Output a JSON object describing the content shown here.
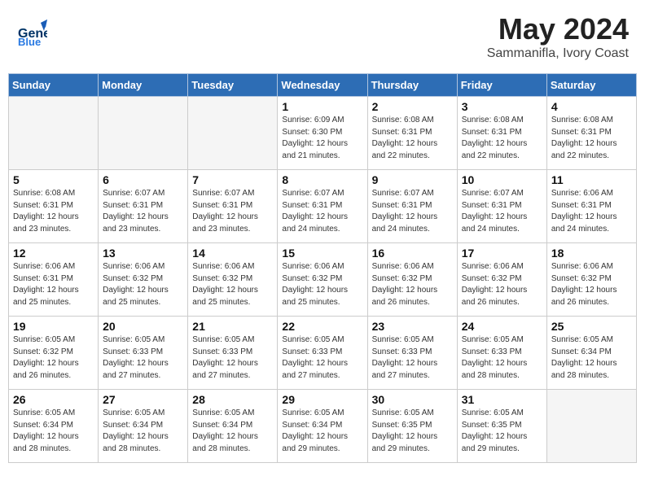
{
  "header": {
    "logo_general": "General",
    "logo_blue": "Blue",
    "month": "May 2024",
    "location": "Sammanifla, Ivory Coast"
  },
  "days_of_week": [
    "Sunday",
    "Monday",
    "Tuesday",
    "Wednesday",
    "Thursday",
    "Friday",
    "Saturday"
  ],
  "weeks": [
    {
      "alt": false,
      "days": [
        {
          "num": "",
          "empty": true,
          "sunrise": "",
          "sunset": "",
          "daylight": ""
        },
        {
          "num": "",
          "empty": true,
          "sunrise": "",
          "sunset": "",
          "daylight": ""
        },
        {
          "num": "",
          "empty": true,
          "sunrise": "",
          "sunset": "",
          "daylight": ""
        },
        {
          "num": "1",
          "empty": false,
          "sunrise": "Sunrise: 6:09 AM",
          "sunset": "Sunset: 6:30 PM",
          "daylight": "Daylight: 12 hours and 21 minutes."
        },
        {
          "num": "2",
          "empty": false,
          "sunrise": "Sunrise: 6:08 AM",
          "sunset": "Sunset: 6:31 PM",
          "daylight": "Daylight: 12 hours and 22 minutes."
        },
        {
          "num": "3",
          "empty": false,
          "sunrise": "Sunrise: 6:08 AM",
          "sunset": "Sunset: 6:31 PM",
          "daylight": "Daylight: 12 hours and 22 minutes."
        },
        {
          "num": "4",
          "empty": false,
          "sunrise": "Sunrise: 6:08 AM",
          "sunset": "Sunset: 6:31 PM",
          "daylight": "Daylight: 12 hours and 22 minutes."
        }
      ]
    },
    {
      "alt": true,
      "days": [
        {
          "num": "5",
          "empty": false,
          "sunrise": "Sunrise: 6:08 AM",
          "sunset": "Sunset: 6:31 PM",
          "daylight": "Daylight: 12 hours and 23 minutes."
        },
        {
          "num": "6",
          "empty": false,
          "sunrise": "Sunrise: 6:07 AM",
          "sunset": "Sunset: 6:31 PM",
          "daylight": "Daylight: 12 hours and 23 minutes."
        },
        {
          "num": "7",
          "empty": false,
          "sunrise": "Sunrise: 6:07 AM",
          "sunset": "Sunset: 6:31 PM",
          "daylight": "Daylight: 12 hours and 23 minutes."
        },
        {
          "num": "8",
          "empty": false,
          "sunrise": "Sunrise: 6:07 AM",
          "sunset": "Sunset: 6:31 PM",
          "daylight": "Daylight: 12 hours and 24 minutes."
        },
        {
          "num": "9",
          "empty": false,
          "sunrise": "Sunrise: 6:07 AM",
          "sunset": "Sunset: 6:31 PM",
          "daylight": "Daylight: 12 hours and 24 minutes."
        },
        {
          "num": "10",
          "empty": false,
          "sunrise": "Sunrise: 6:07 AM",
          "sunset": "Sunset: 6:31 PM",
          "daylight": "Daylight: 12 hours and 24 minutes."
        },
        {
          "num": "11",
          "empty": false,
          "sunrise": "Sunrise: 6:06 AM",
          "sunset": "Sunset: 6:31 PM",
          "daylight": "Daylight: 12 hours and 24 minutes."
        }
      ]
    },
    {
      "alt": false,
      "days": [
        {
          "num": "12",
          "empty": false,
          "sunrise": "Sunrise: 6:06 AM",
          "sunset": "Sunset: 6:31 PM",
          "daylight": "Daylight: 12 hours and 25 minutes."
        },
        {
          "num": "13",
          "empty": false,
          "sunrise": "Sunrise: 6:06 AM",
          "sunset": "Sunset: 6:32 PM",
          "daylight": "Daylight: 12 hours and 25 minutes."
        },
        {
          "num": "14",
          "empty": false,
          "sunrise": "Sunrise: 6:06 AM",
          "sunset": "Sunset: 6:32 PM",
          "daylight": "Daylight: 12 hours and 25 minutes."
        },
        {
          "num": "15",
          "empty": false,
          "sunrise": "Sunrise: 6:06 AM",
          "sunset": "Sunset: 6:32 PM",
          "daylight": "Daylight: 12 hours and 25 minutes."
        },
        {
          "num": "16",
          "empty": false,
          "sunrise": "Sunrise: 6:06 AM",
          "sunset": "Sunset: 6:32 PM",
          "daylight": "Daylight: 12 hours and 26 minutes."
        },
        {
          "num": "17",
          "empty": false,
          "sunrise": "Sunrise: 6:06 AM",
          "sunset": "Sunset: 6:32 PM",
          "daylight": "Daylight: 12 hours and 26 minutes."
        },
        {
          "num": "18",
          "empty": false,
          "sunrise": "Sunrise: 6:06 AM",
          "sunset": "Sunset: 6:32 PM",
          "daylight": "Daylight: 12 hours and 26 minutes."
        }
      ]
    },
    {
      "alt": true,
      "days": [
        {
          "num": "19",
          "empty": false,
          "sunrise": "Sunrise: 6:05 AM",
          "sunset": "Sunset: 6:32 PM",
          "daylight": "Daylight: 12 hours and 26 minutes."
        },
        {
          "num": "20",
          "empty": false,
          "sunrise": "Sunrise: 6:05 AM",
          "sunset": "Sunset: 6:33 PM",
          "daylight": "Daylight: 12 hours and 27 minutes."
        },
        {
          "num": "21",
          "empty": false,
          "sunrise": "Sunrise: 6:05 AM",
          "sunset": "Sunset: 6:33 PM",
          "daylight": "Daylight: 12 hours and 27 minutes."
        },
        {
          "num": "22",
          "empty": false,
          "sunrise": "Sunrise: 6:05 AM",
          "sunset": "Sunset: 6:33 PM",
          "daylight": "Daylight: 12 hours and 27 minutes."
        },
        {
          "num": "23",
          "empty": false,
          "sunrise": "Sunrise: 6:05 AM",
          "sunset": "Sunset: 6:33 PM",
          "daylight": "Daylight: 12 hours and 27 minutes."
        },
        {
          "num": "24",
          "empty": false,
          "sunrise": "Sunrise: 6:05 AM",
          "sunset": "Sunset: 6:33 PM",
          "daylight": "Daylight: 12 hours and 28 minutes."
        },
        {
          "num": "25",
          "empty": false,
          "sunrise": "Sunrise: 6:05 AM",
          "sunset": "Sunset: 6:34 PM",
          "daylight": "Daylight: 12 hours and 28 minutes."
        }
      ]
    },
    {
      "alt": false,
      "days": [
        {
          "num": "26",
          "empty": false,
          "sunrise": "Sunrise: 6:05 AM",
          "sunset": "Sunset: 6:34 PM",
          "daylight": "Daylight: 12 hours and 28 minutes."
        },
        {
          "num": "27",
          "empty": false,
          "sunrise": "Sunrise: 6:05 AM",
          "sunset": "Sunset: 6:34 PM",
          "daylight": "Daylight: 12 hours and 28 minutes."
        },
        {
          "num": "28",
          "empty": false,
          "sunrise": "Sunrise: 6:05 AM",
          "sunset": "Sunset: 6:34 PM",
          "daylight": "Daylight: 12 hours and 28 minutes."
        },
        {
          "num": "29",
          "empty": false,
          "sunrise": "Sunrise: 6:05 AM",
          "sunset": "Sunset: 6:34 PM",
          "daylight": "Daylight: 12 hours and 29 minutes."
        },
        {
          "num": "30",
          "empty": false,
          "sunrise": "Sunrise: 6:05 AM",
          "sunset": "Sunset: 6:35 PM",
          "daylight": "Daylight: 12 hours and 29 minutes."
        },
        {
          "num": "31",
          "empty": false,
          "sunrise": "Sunrise: 6:05 AM",
          "sunset": "Sunset: 6:35 PM",
          "daylight": "Daylight: 12 hours and 29 minutes."
        },
        {
          "num": "",
          "empty": true,
          "sunrise": "",
          "sunset": "",
          "daylight": ""
        }
      ]
    }
  ]
}
